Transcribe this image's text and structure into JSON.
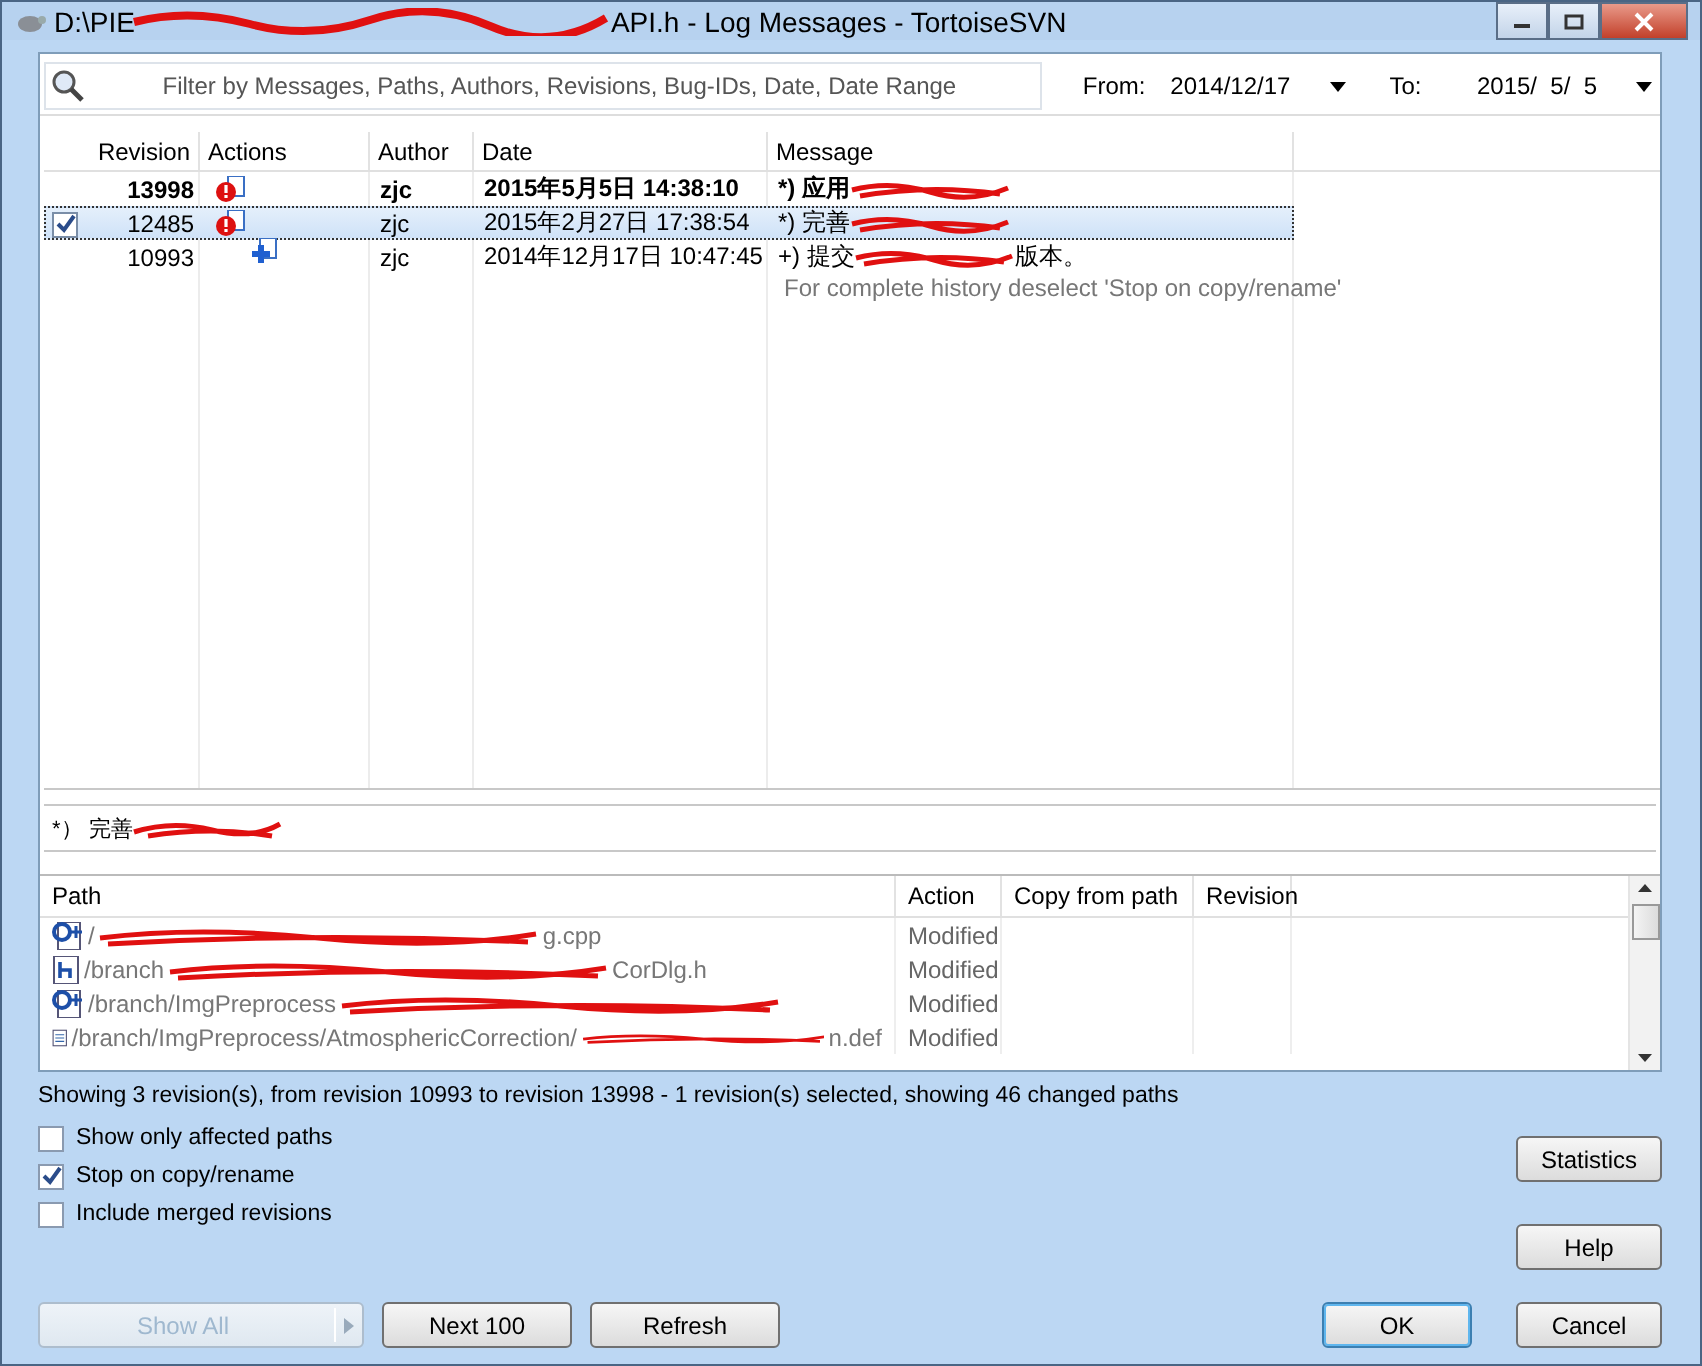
{
  "window": {
    "title": "API.h - Log Messages - TortoiseSVN",
    "title_start": "D:\\PIE"
  },
  "filter": {
    "placeholder": "Filter by Messages, Paths, Authors, Revisions, Bug-IDs, Date, Date Range"
  },
  "from": {
    "label": "From:",
    "value": "2014/12/17"
  },
  "to": {
    "label": "To:",
    "value": "2015/  5/  5"
  },
  "log": {
    "columns": [
      "Revision",
      "Actions",
      "Author",
      "Date",
      "Message"
    ],
    "rows": [
      {
        "revision": "13998",
        "kind": "modified",
        "author": "zjc",
        "date": "2015年5月5日 14:38:10",
        "message": "*) 应用",
        "message_end": "",
        "current": true,
        "selected": false,
        "checked": false
      },
      {
        "revision": "12485",
        "kind": "modified",
        "author": "zjc",
        "date": "2015年2月27日 17:38:54",
        "message": "*) 完善",
        "message_end": "",
        "current": false,
        "selected": true,
        "checked": true
      },
      {
        "revision": "10993",
        "kind": "added",
        "author": "zjc",
        "date": "2014年12月17日 10:47:45",
        "message": "+) 提交",
        "message_end": "版本。",
        "current": false,
        "selected": false,
        "checked": false
      }
    ],
    "note": "For complete history deselect 'Stop on copy/rename'"
  },
  "detail": {
    "message": "*） 完善"
  },
  "paths": {
    "columns": [
      "Path",
      "Action",
      "Copy from path",
      "Revision"
    ],
    "rows": [
      {
        "kind": "cpp",
        "path": "/",
        "path_end": "g.cpp",
        "action": "Modified"
      },
      {
        "kind": "h",
        "path": "/branch",
        "path_end": "CorDlg.h",
        "action": "Modified"
      },
      {
        "kind": "cpp",
        "path": "/branch/ImgPreprocess",
        "path_end": "",
        "action": "Modified"
      },
      {
        "kind": "def",
        "path": "/branch/ImgPreprocess/AtmosphericCorrection/",
        "path_end": "n.def",
        "action": "Modified"
      }
    ]
  },
  "status": "Showing 3 revision(s), from revision 10993 to revision 13998 - 1 revision(s) selected, showing 46 changed paths",
  "options": [
    {
      "label": "Show only affected paths",
      "checked": false
    },
    {
      "label": "Stop on copy/rename",
      "checked": true
    },
    {
      "label": "Include merged revisions",
      "checked": false
    }
  ],
  "side_buttons": [
    "Statistics",
    "Help"
  ],
  "buttons": [
    {
      "label": "Show All",
      "disabled": true,
      "kind": "split"
    },
    {
      "label": "Next 100",
      "disabled": false,
      "kind": "plain"
    },
    {
      "label": "Refresh",
      "disabled": false,
      "kind": "plain"
    }
  ],
  "ok": {
    "label": "OK",
    "default": true
  },
  "cancel": {
    "label": "Cancel"
  }
}
